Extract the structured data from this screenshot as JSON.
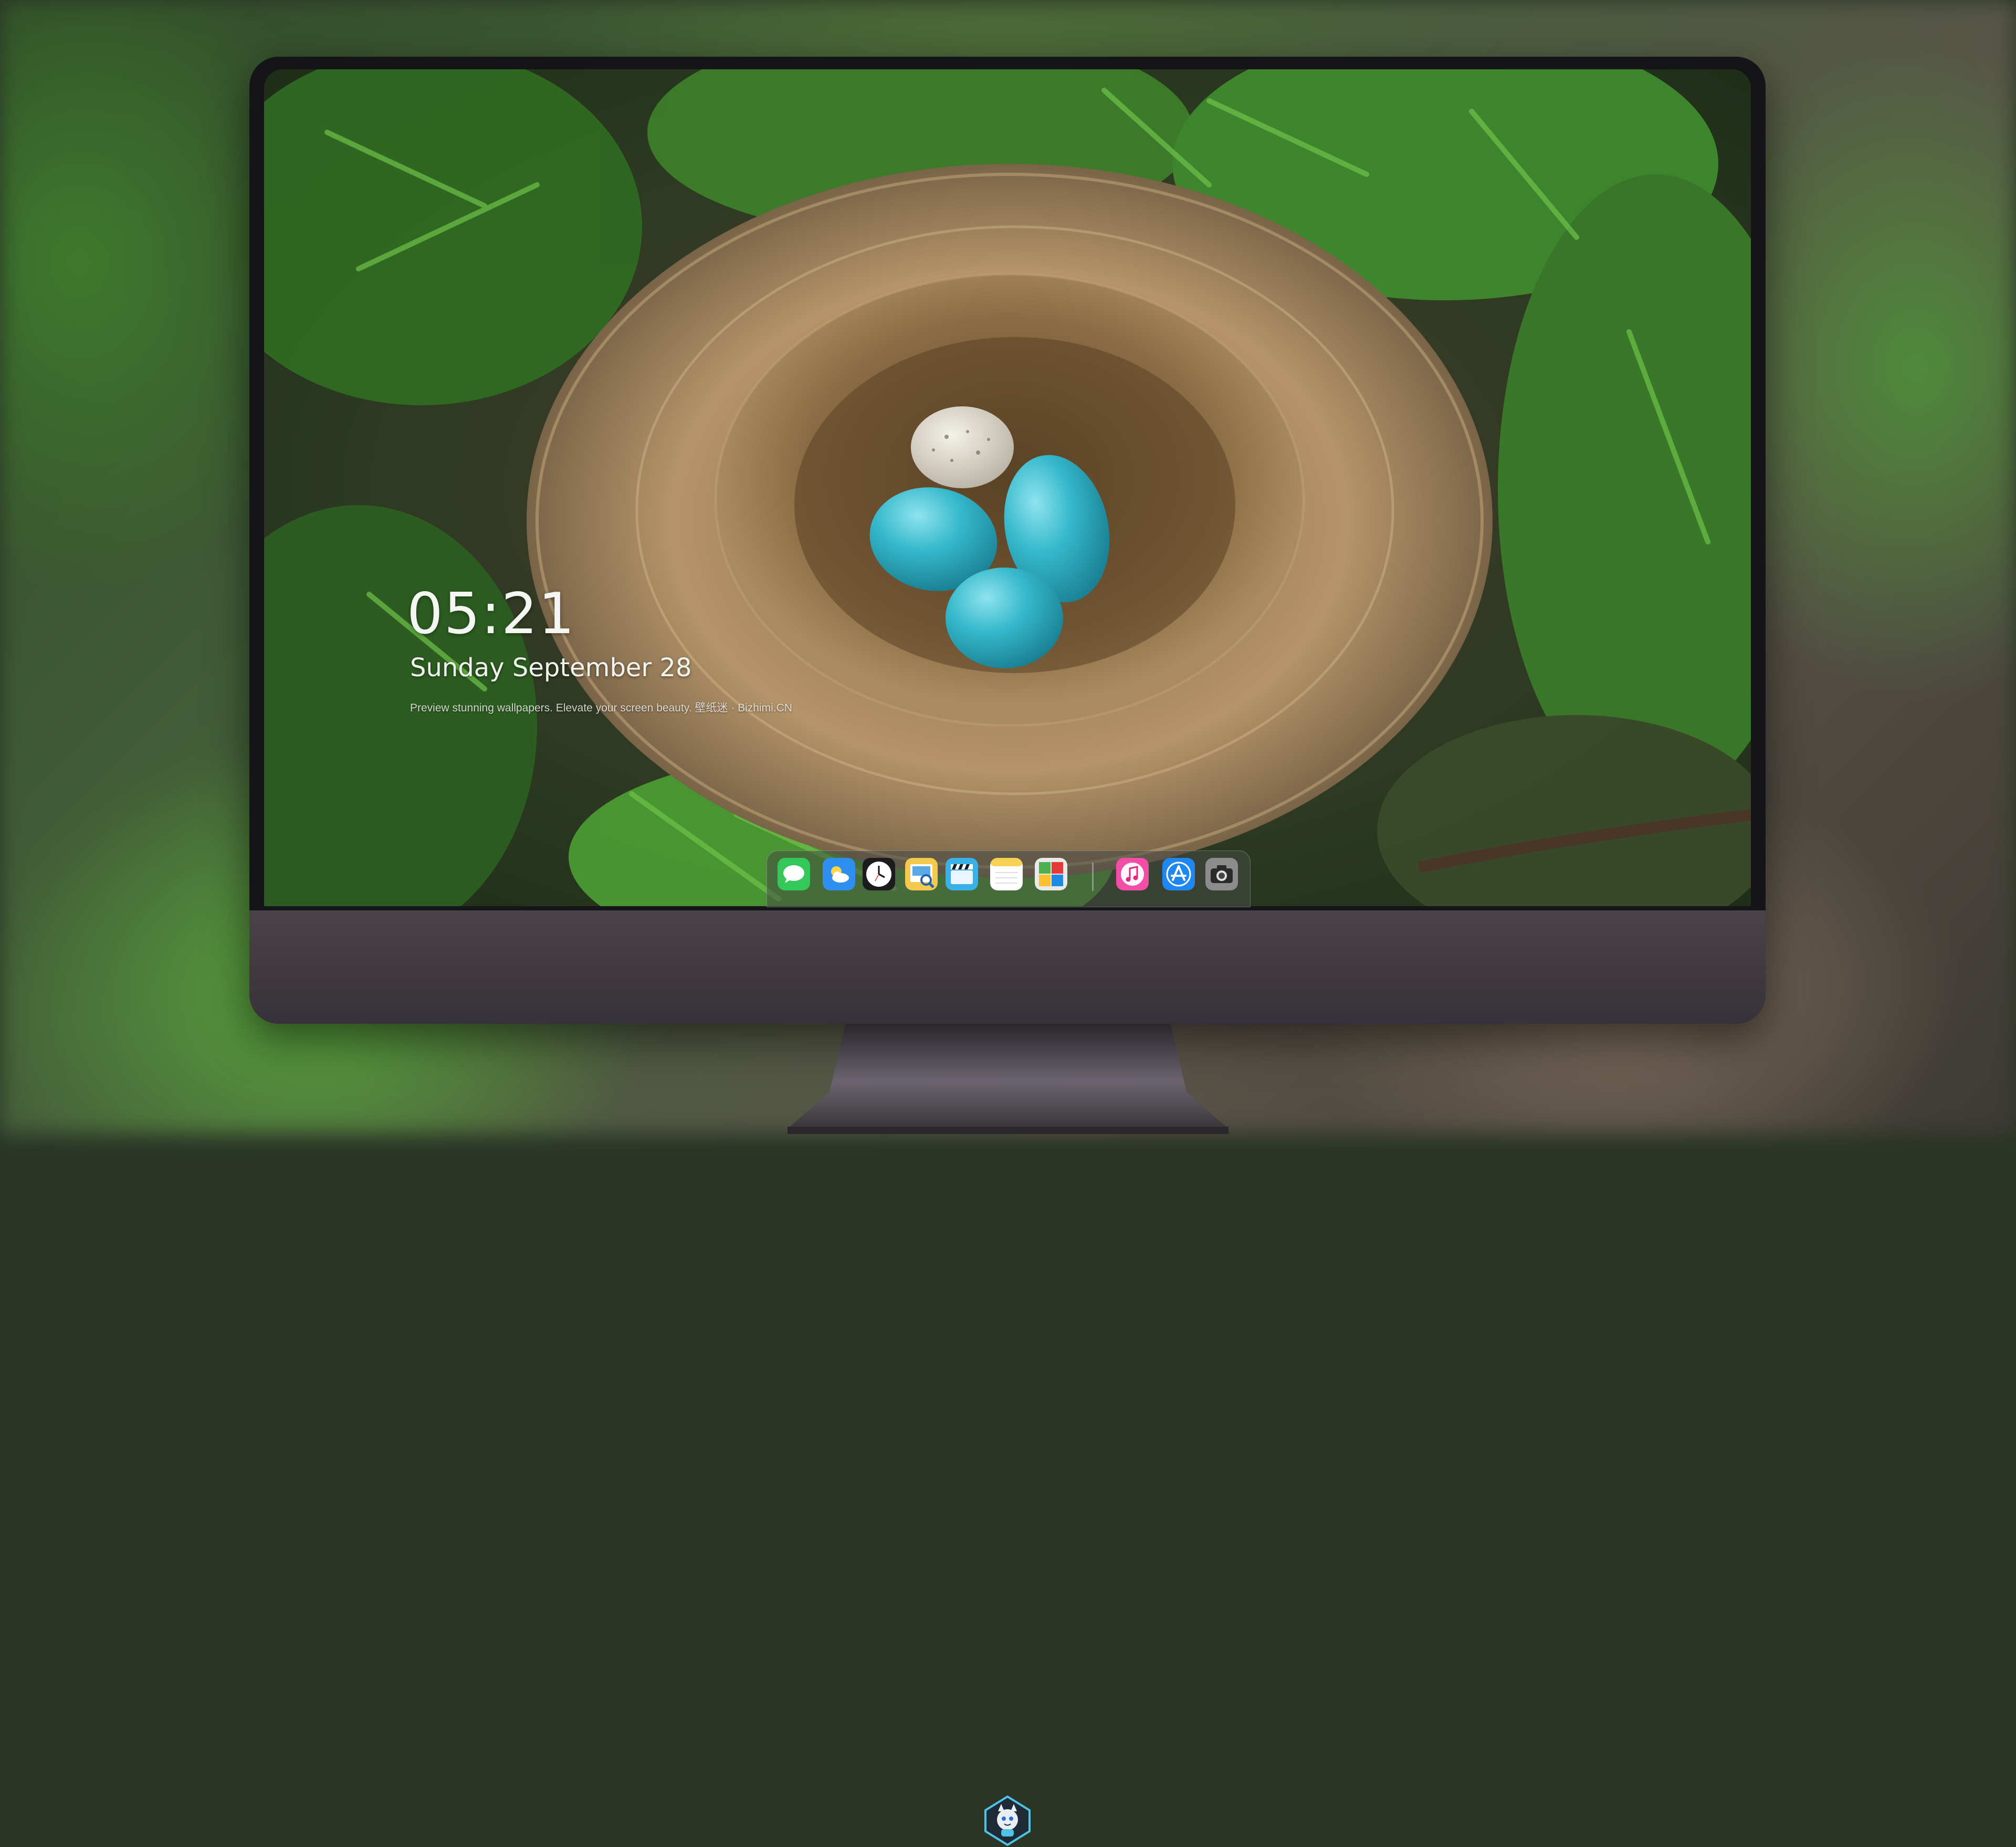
{
  "lock_screen": {
    "time": "05:21",
    "date": "Sunday September  28",
    "tagline": "Preview stunning wallpapers. Elevate your screen beauty. 壁纸迷 · Bizhimi.CN"
  },
  "dock": {
    "apps": [
      {
        "name": "messages-icon",
        "color": "#34c759"
      },
      {
        "name": "weather-icon",
        "color": "#2f8ff0"
      },
      {
        "name": "clock-icon",
        "color": "#1c1c1e"
      },
      {
        "name": "preview-icon",
        "color": "#f2c94c"
      },
      {
        "name": "clips-icon",
        "color": "#3ab0e8"
      },
      {
        "name": "notes-icon",
        "color": "#f7d154"
      },
      {
        "name": "photo-booth-icon",
        "color": "#e9e9e9"
      },
      {
        "name": "music-icon",
        "color": "#f24ea8"
      },
      {
        "name": "app-store-icon",
        "color": "#1e88f0"
      },
      {
        "name": "camera-icon",
        "color": "#8c8c8c"
      }
    ]
  },
  "colors": {
    "accent_egg": "#33b8cc",
    "bezel": "#151517",
    "chin": "#403a3f"
  }
}
